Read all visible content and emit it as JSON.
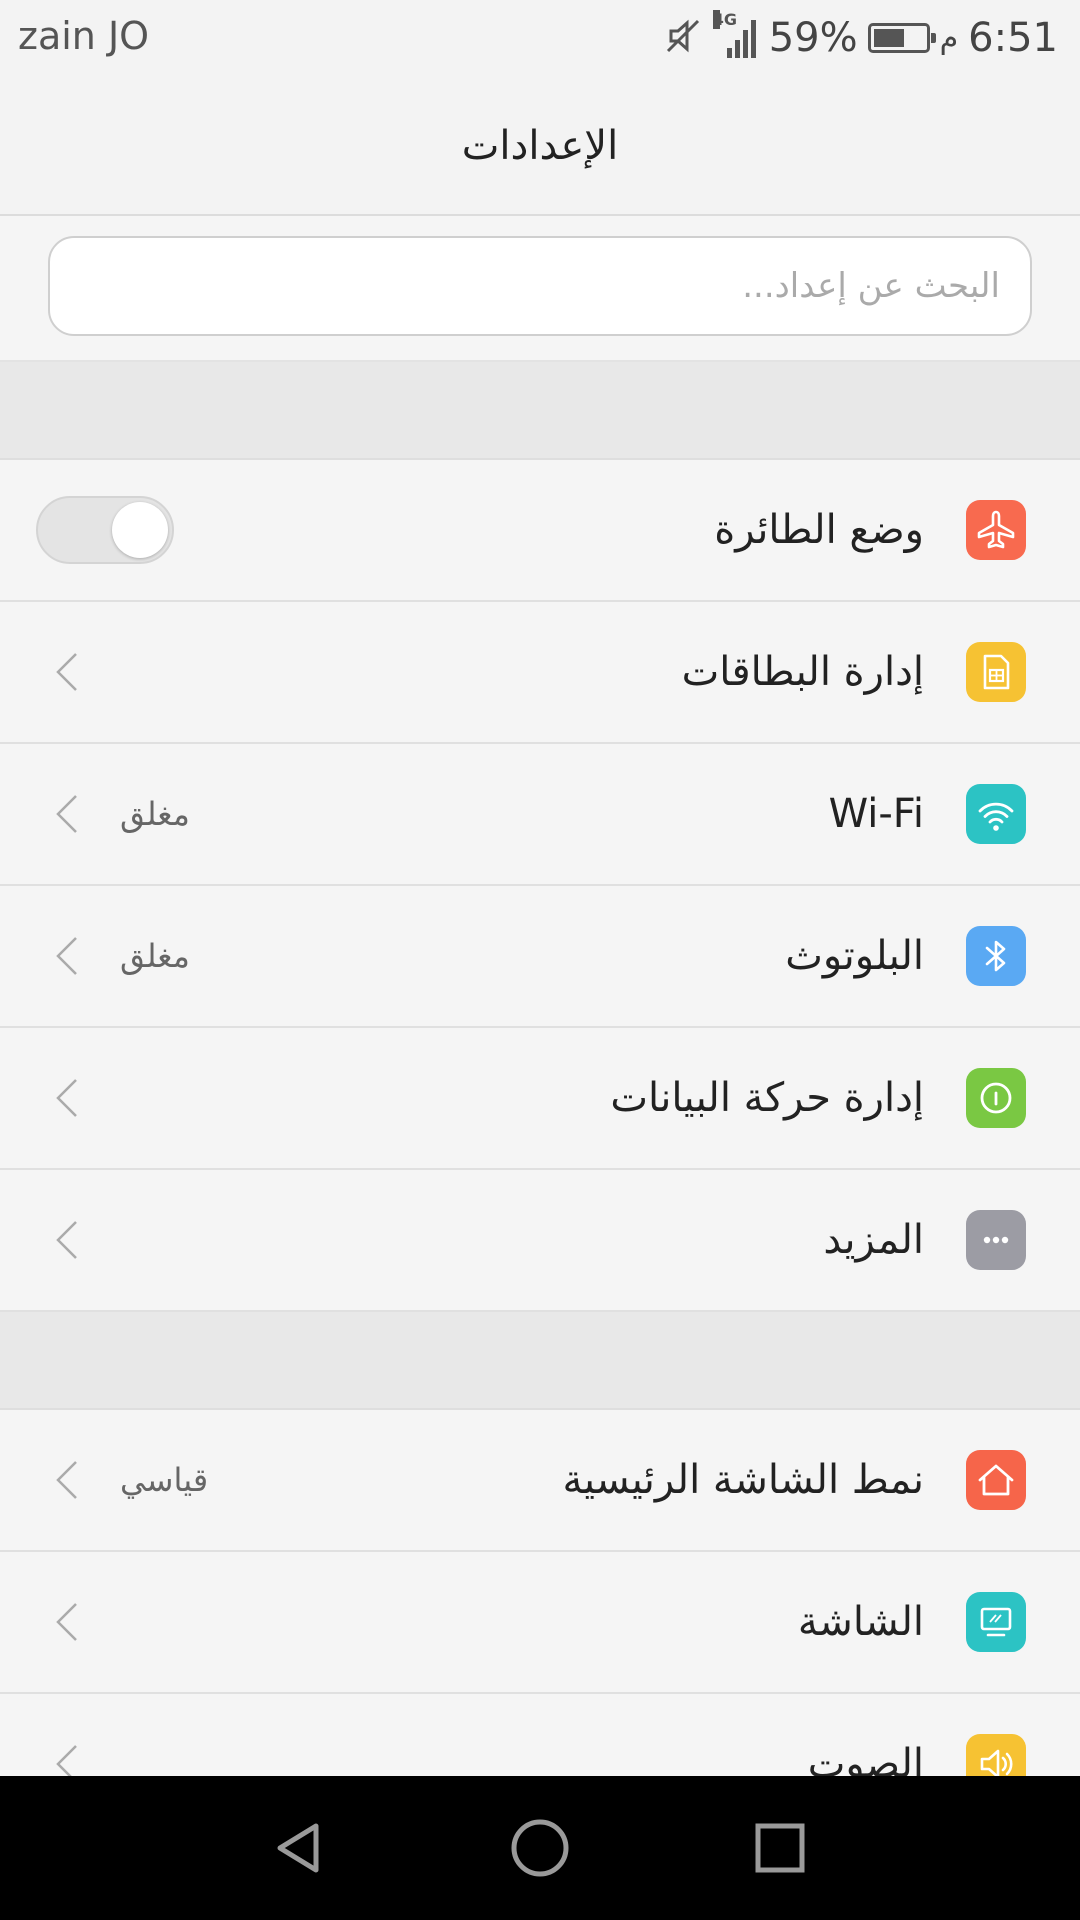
{
  "status_bar": {
    "carrier": "zain JO",
    "time": "6:51",
    "am_pm": "م",
    "battery": "59%",
    "battery_level": 0.59,
    "network": "4G",
    "icons": [
      "mute-icon",
      "signal-icon",
      "battery-icon"
    ]
  },
  "header": {
    "title": "الإعدادات"
  },
  "search": {
    "placeholder": "البحث عن إعداد..."
  },
  "colors": {
    "airplane": "#f86a4f",
    "sim": "#f6c233",
    "wifi": "#2cc3c4",
    "bluetooth": "#5aa9f3",
    "data": "#7ac843",
    "more": "#9c9ca4",
    "home": "#f6654a",
    "display": "#2cc3c4",
    "sound": "#f6c233"
  },
  "rows": [
    {
      "label": "وضع الطائرة",
      "icon": "airplane-icon",
      "toggle": false
    },
    {
      "label": "إدارة البطاقات",
      "icon": "sim-card-icon"
    },
    {
      "label": "Wi-Fi",
      "icon": "wifi-icon",
      "value": "مغلق"
    },
    {
      "label": "البلوتوث",
      "icon": "bluetooth-icon",
      "value": "مغلق"
    },
    {
      "label": "إدارة حركة البيانات",
      "icon": "data-usage-icon"
    },
    {
      "label": "المزيد",
      "icon": "more-icon"
    },
    {
      "label": "نمط الشاشة الرئيسية",
      "icon": "home-icon",
      "value": "قياسي"
    },
    {
      "label": "الشاشة",
      "icon": "display-icon"
    },
    {
      "label": "الصوت",
      "icon": "sound-icon"
    }
  ],
  "nav": [
    "back-icon",
    "home-nav-icon",
    "recents-icon"
  ]
}
